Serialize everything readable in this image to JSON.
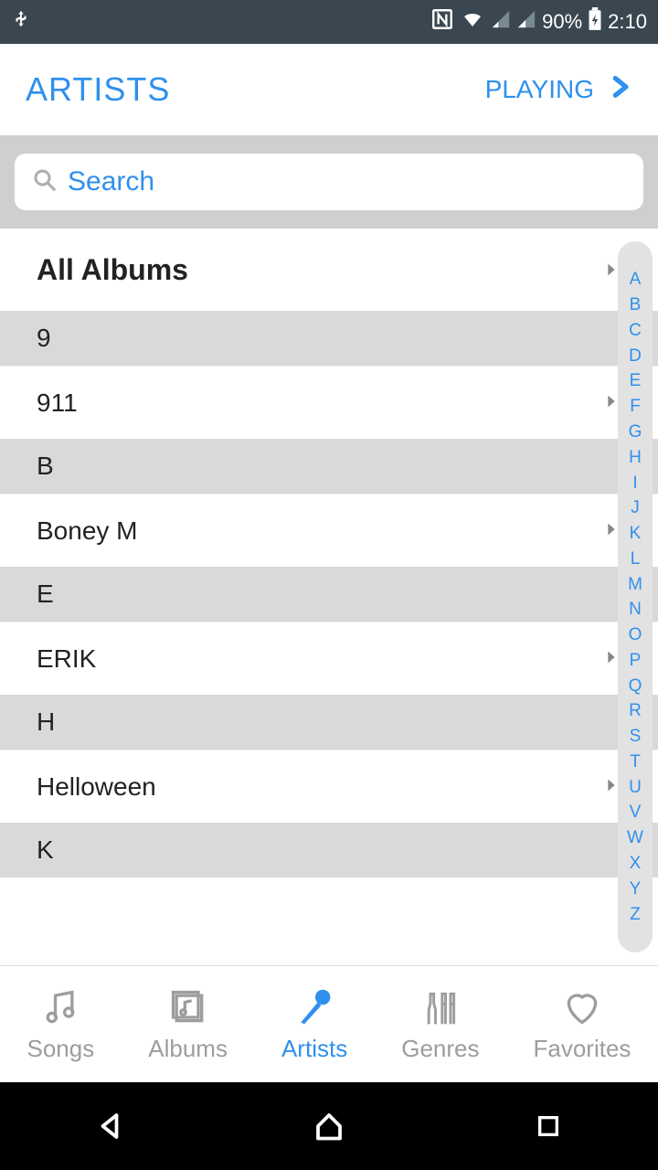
{
  "status": {
    "battery_pct": "90%",
    "time": "2:10"
  },
  "header": {
    "title": "ARTISTS",
    "playing_label": "PLAYING"
  },
  "search": {
    "placeholder": "Search"
  },
  "all_label": "All Albums",
  "sections": [
    {
      "header": "9",
      "items": [
        "911"
      ]
    },
    {
      "header": "B",
      "items": [
        "Boney M"
      ]
    },
    {
      "header": "E",
      "items": [
        "ERIK"
      ]
    },
    {
      "header": "H",
      "items": [
        "Helloween"
      ]
    },
    {
      "header": "K",
      "items": []
    }
  ],
  "index_strip": [
    "A",
    "B",
    "C",
    "D",
    "E",
    "F",
    "G",
    "H",
    "I",
    "J",
    "K",
    "L",
    "M",
    "N",
    "O",
    "P",
    "Q",
    "R",
    "S",
    "T",
    "U",
    "V",
    "W",
    "X",
    "Y",
    "Z"
  ],
  "bottom_nav": {
    "songs": "Songs",
    "albums": "Albums",
    "artists": "Artists",
    "genres": "Genres",
    "favorites": "Favorites"
  }
}
